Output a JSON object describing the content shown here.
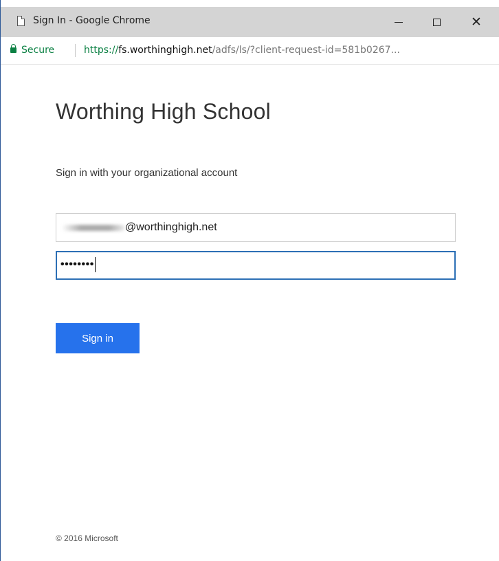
{
  "window": {
    "title": "Sign In - Google Chrome"
  },
  "address_bar": {
    "secure_label": "Secure",
    "url_scheme": "https://",
    "url_host": "fs.worthinghigh.net",
    "url_path": "/adfs/ls/?client-request-id=581b0267..."
  },
  "page": {
    "org_name": "Worthing High School",
    "subtitle": "Sign in with your organizational account",
    "username_value": "@worthinghigh.net",
    "password_mask": "••••••••",
    "signin_label": "Sign in",
    "footer": "© 2016 Microsoft"
  },
  "colors": {
    "accent": "#2672ec",
    "secure_green": "#0b8043",
    "titlebar": "#d4d4d4"
  },
  "icons": [
    "page-icon",
    "minimize-icon",
    "maximize-icon",
    "close-icon",
    "lock-icon"
  ]
}
